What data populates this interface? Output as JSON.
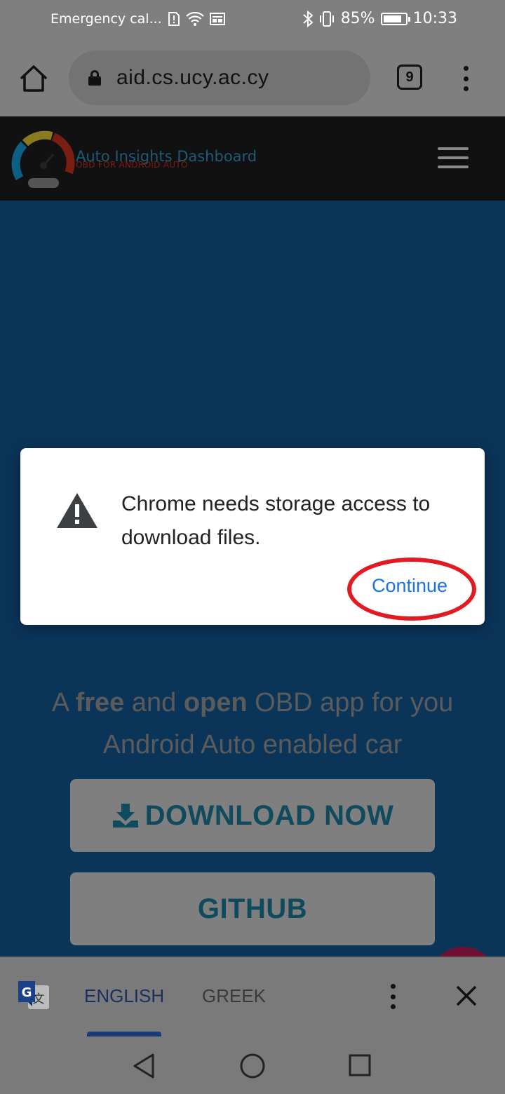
{
  "status_bar": {
    "left_text": "Emergency cal...",
    "battery_percent": "85%",
    "battery_level": 0.85,
    "time": "10:33"
  },
  "browser": {
    "url": "aid.cs.ucy.ac.cy",
    "tab_count": "9"
  },
  "site": {
    "brand_title": "Auto Insights Dashboard",
    "brand_subtitle": "OBD FOR ANDROID AUTO",
    "tagline_parts": {
      "p1": "A ",
      "free": "free",
      "p2": " and ",
      "open": "open",
      "p3": " OBD app for you Android Auto enabled car"
    },
    "download_label": "DOWNLOAD NOW",
    "github_label": "GITHUB"
  },
  "dialog": {
    "message": "Chrome needs storage access to download files.",
    "continue_label": "Continue"
  },
  "translate_bar": {
    "languages": [
      "ENGLISH",
      "GREEK"
    ],
    "selected": "ENGLISH"
  },
  "colors": {
    "accent": "#1a73e8",
    "highlight": "#e01b22",
    "hero_background": "#0b3459"
  },
  "icons": {
    "home": "home-icon",
    "lock": "lock-icon",
    "warning": "warning-icon",
    "download": "download-icon",
    "translate": "google-translate-icon",
    "close": "close-icon",
    "back": "back-triangle-icon",
    "home_nav": "home-circle-icon",
    "recents": "recents-square-icon"
  }
}
